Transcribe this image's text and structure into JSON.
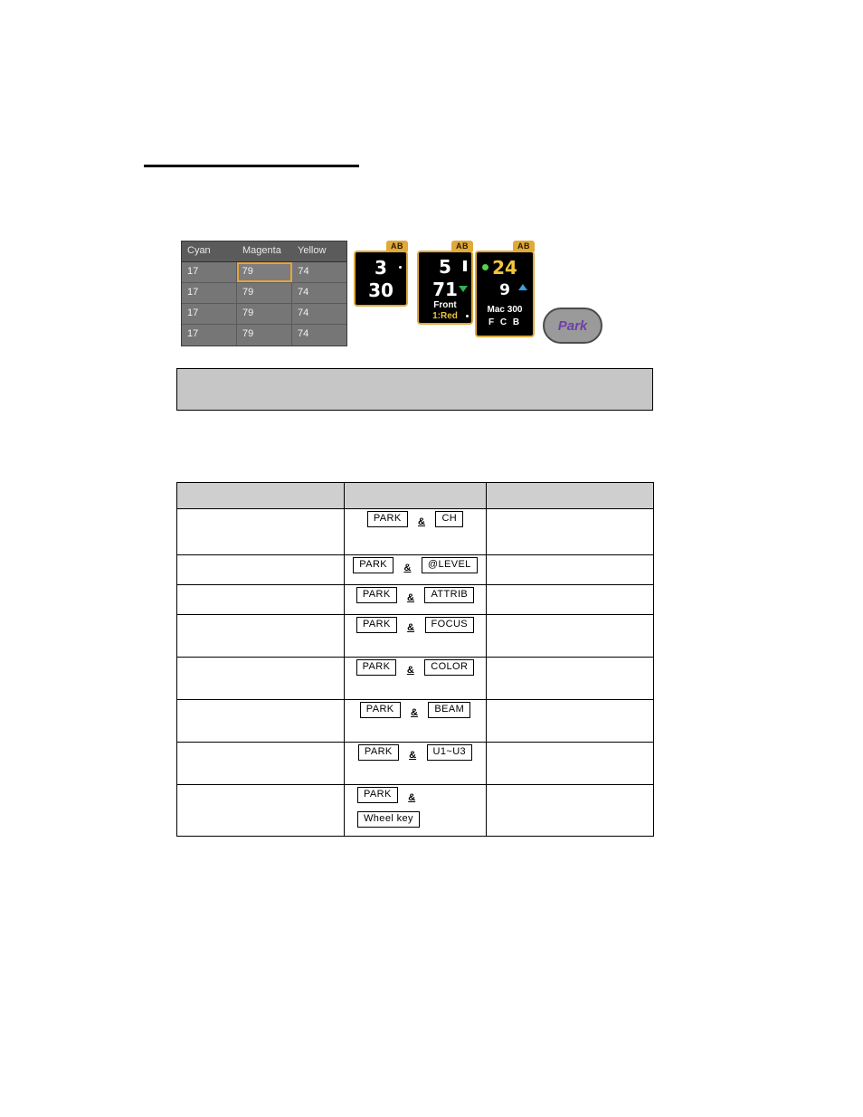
{
  "cmy_table": {
    "headers": [
      "Cyan",
      "Magenta",
      "Yellow"
    ],
    "rows": [
      [
        "17",
        "79",
        "74"
      ],
      [
        "17",
        "79",
        "74"
      ],
      [
        "17",
        "79",
        "74"
      ],
      [
        "17",
        "79",
        "74"
      ]
    ],
    "selected_cell": {
      "row": 0,
      "col": 1,
      "value": "79"
    },
    "selection_color": "#e8a33d"
  },
  "encoders": [
    {
      "tab": "AB",
      "top_value": "3",
      "bottom_value": "30",
      "sub1": "",
      "sub2": "",
      "marker_top": "dot-sm",
      "marker_bottom": ""
    },
    {
      "tab": "AB",
      "top_value": "5",
      "bottom_value": "71",
      "sub1": "Front",
      "sub2": "1:Red",
      "marker_top": "bar-white",
      "marker_bottom": "tri-down"
    },
    {
      "tab": "AB",
      "top_value": "24",
      "bottom_value": "9",
      "sub1": "Mac 300",
      "sub2": "F  C  B",
      "marker_top": "dot-green",
      "marker_bottom": "tri-up"
    }
  ],
  "park_button": {
    "label": "Park"
  },
  "note_box": {
    "text": ""
  },
  "keys_table": {
    "headers": [
      "",
      "",
      ""
    ],
    "rows": [
      {
        "left": "",
        "keys": [
          "PARK",
          "CH"
        ],
        "conj": "&",
        "right": "",
        "two_line": false
      },
      {
        "left": "",
        "keys": [
          "PARK",
          "@LEVEL"
        ],
        "conj": "&",
        "right": "",
        "two_line": false
      },
      {
        "left": "",
        "keys": [
          "PARK",
          "ATTRIB"
        ],
        "conj": "&",
        "right": "",
        "two_line": false
      },
      {
        "left": "",
        "keys": [
          "PARK",
          "FOCUS"
        ],
        "conj": "&",
        "right": "",
        "two_line": false
      },
      {
        "left": "",
        "keys": [
          "PARK",
          "COLOR"
        ],
        "conj": "&",
        "right": "",
        "two_line": false
      },
      {
        "left": "",
        "keys": [
          "PARK",
          "BEAM"
        ],
        "conj": "&",
        "right": "",
        "two_line": false
      },
      {
        "left": "",
        "keys": [
          "PARK",
          "U1~U3"
        ],
        "conj": "&",
        "right": "",
        "two_line": false
      },
      {
        "left": "",
        "keys": [
          "PARK",
          "Wheel key"
        ],
        "conj": "&",
        "right": "",
        "two_line": true
      }
    ]
  }
}
